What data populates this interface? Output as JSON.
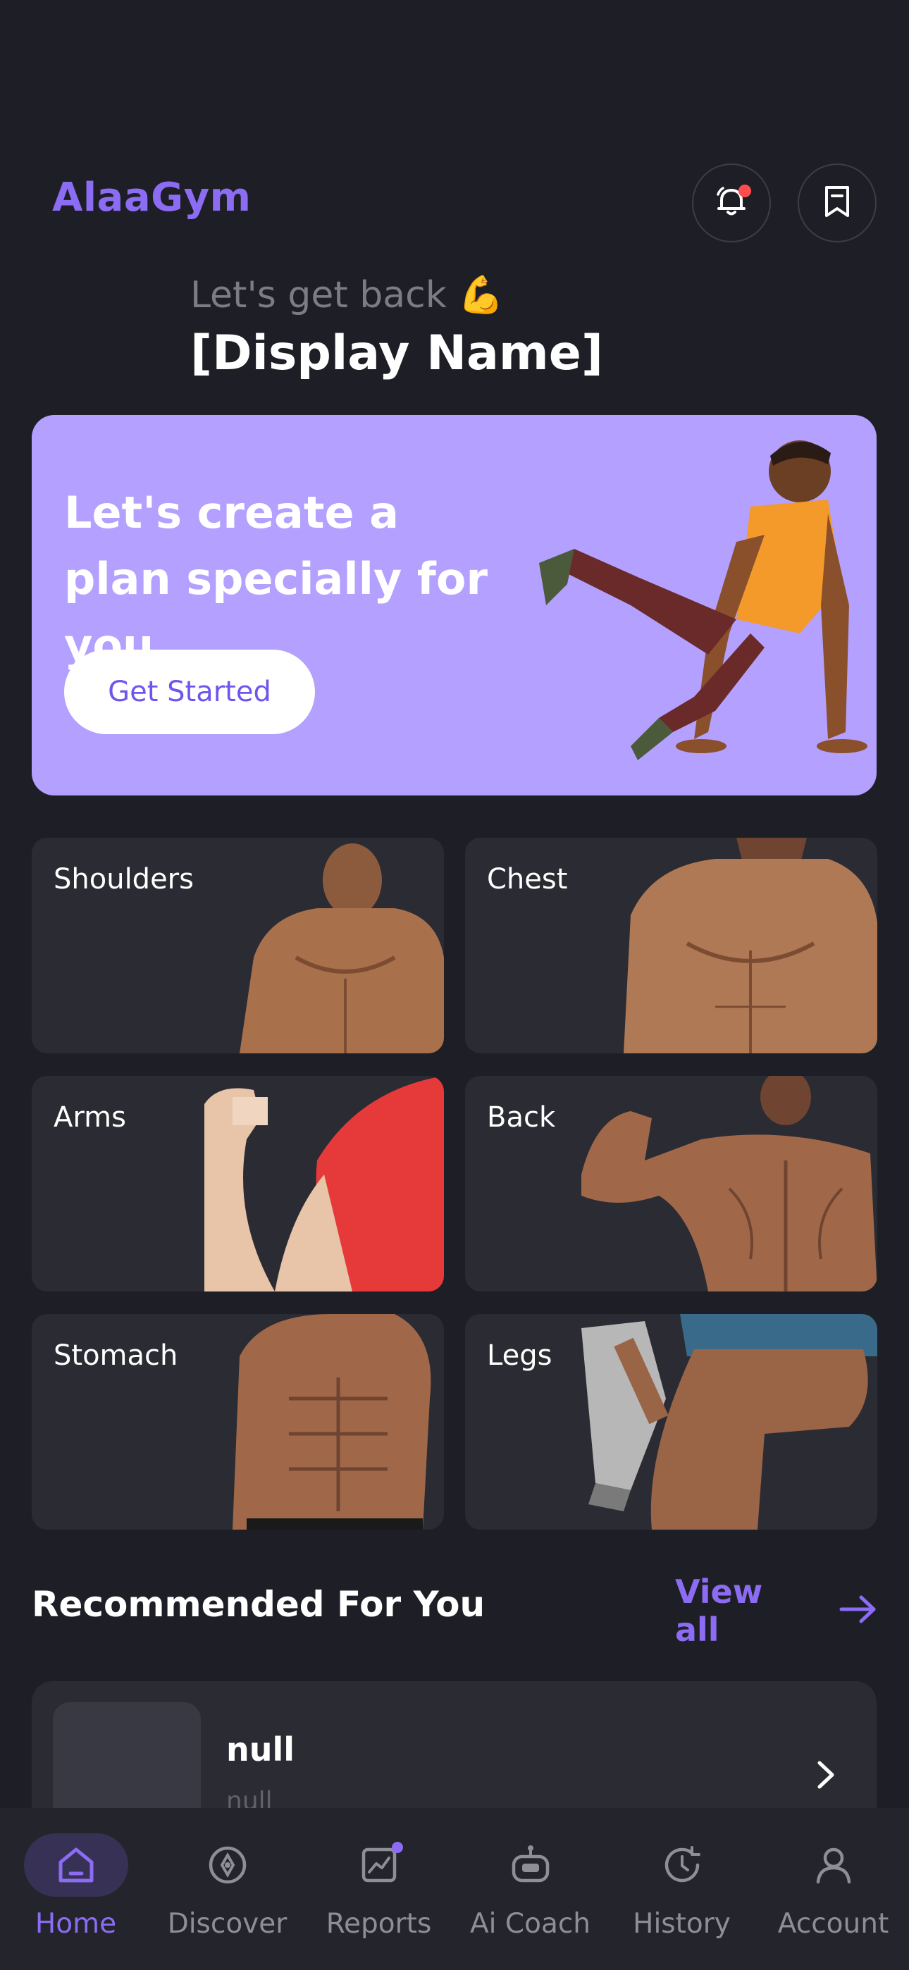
{
  "header": {
    "brand": "AlaaGym",
    "notification_icon": "bell-icon",
    "bookmark_icon": "bookmark-icon",
    "notification_dot_color": "#ff4d4f"
  },
  "greeting": {
    "line1": "Let's get back 💪",
    "display_name": "[Display Name]"
  },
  "banner": {
    "title": "Let's create a plan specially for you",
    "cta_label": "Get Started",
    "background": "#b3a0ff"
  },
  "muscle_groups": [
    {
      "label": "Shoulders"
    },
    {
      "label": "Chest"
    },
    {
      "label": "Arms"
    },
    {
      "label": "Back"
    },
    {
      "label": "Stomach"
    },
    {
      "label": "Legs"
    }
  ],
  "recommended": {
    "title": "Recommended For You",
    "view_all": "View all",
    "items": [
      {
        "title": "null",
        "subtitle": "null"
      }
    ]
  },
  "bottom_nav": {
    "items": [
      {
        "label": "Home",
        "icon": "home-icon",
        "active": true
      },
      {
        "label": "Discover",
        "icon": "compass-icon",
        "active": false
      },
      {
        "label": "Reports",
        "icon": "chart-icon",
        "active": false
      },
      {
        "label": "Ai Coach",
        "icon": "robot-icon",
        "active": false
      },
      {
        "label": "History",
        "icon": "history-icon",
        "active": false
      },
      {
        "label": "Account",
        "icon": "user-icon",
        "active": false
      }
    ]
  },
  "colors": {
    "accent": "#8b6cf3",
    "background": "#1e1f26",
    "card": "#2b2b33"
  }
}
